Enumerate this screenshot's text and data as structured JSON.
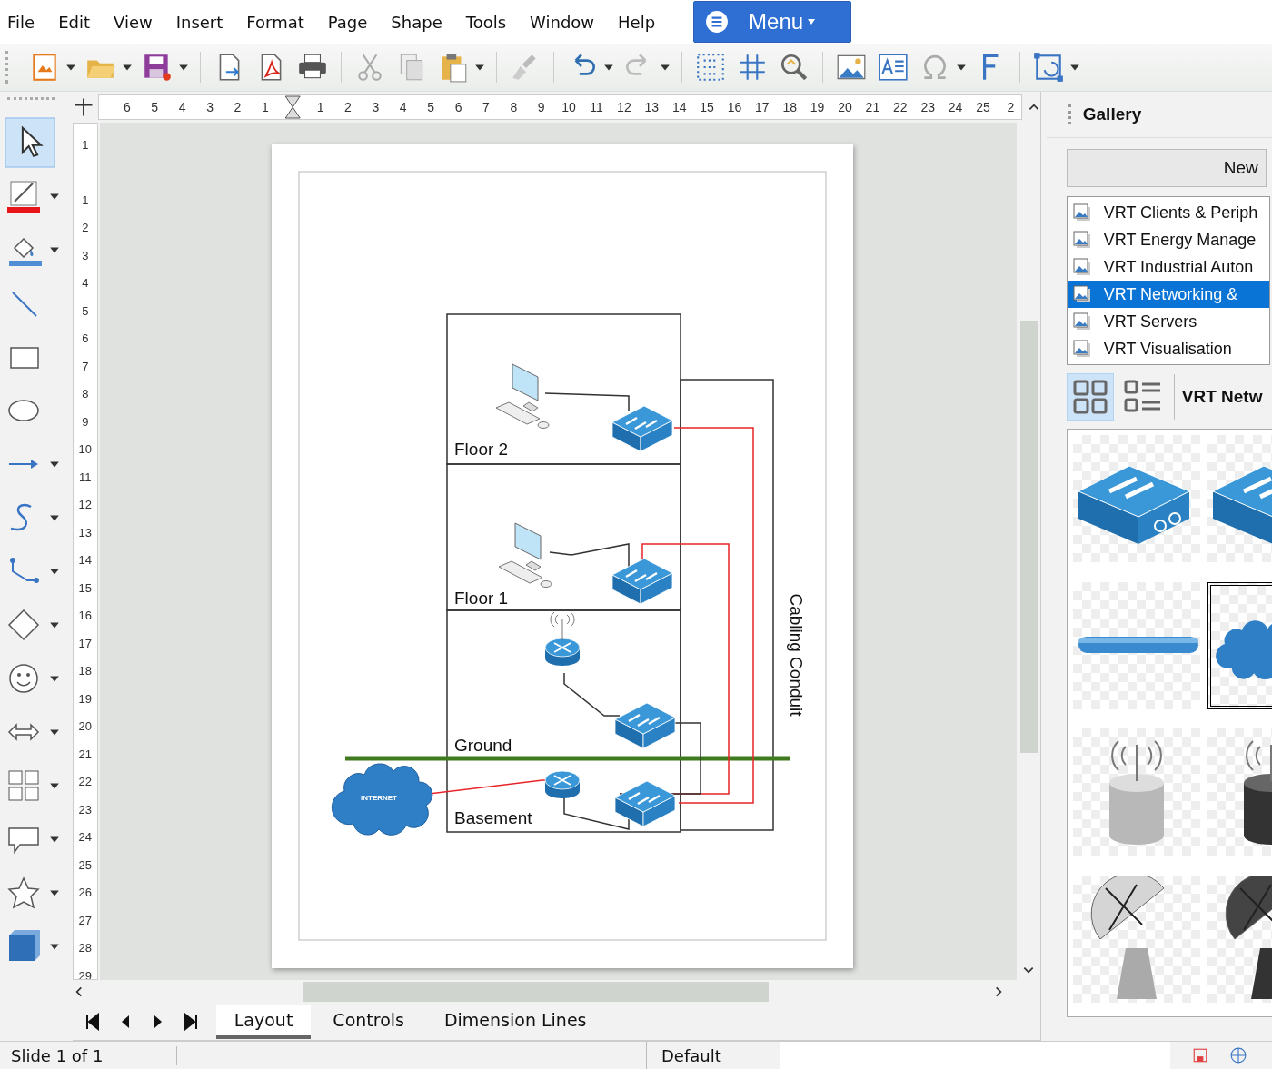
{
  "menu_bar": {
    "items": [
      "File",
      "Edit",
      "View",
      "Insert",
      "Format",
      "Page",
      "Shape",
      "Tools",
      "Window",
      "Help"
    ],
    "menu_button": "Menu"
  },
  "rulers": {
    "horizontal_before": [
      "6",
      "5",
      "4",
      "3",
      "2",
      "1"
    ],
    "horizontal_after": [
      "1",
      "2",
      "3",
      "4",
      "5",
      "6",
      "7",
      "8",
      "9",
      "10",
      "11",
      "12",
      "13",
      "14",
      "15",
      "16",
      "17",
      "18",
      "19",
      "20",
      "21",
      "22",
      "23",
      "24",
      "25",
      "2"
    ],
    "vertical_before": [
      "1"
    ],
    "vertical_after": [
      "1",
      "2",
      "3",
      "4",
      "5",
      "6",
      "7",
      "8",
      "9",
      "10",
      "11",
      "12",
      "13",
      "14",
      "15",
      "16",
      "17",
      "18",
      "19",
      "20",
      "21",
      "22",
      "23",
      "24",
      "25",
      "26",
      "27",
      "28",
      "29"
    ]
  },
  "diagram": {
    "floor_labels": [
      "Floor 2",
      "Floor 1",
      "Ground",
      "Basement"
    ],
    "conduit_label": "Cabling Conduit",
    "cloud_label": "INTERNET"
  },
  "page_tabs": [
    {
      "label": "Layout",
      "selected": true
    },
    {
      "label": "Controls",
      "selected": false
    },
    {
      "label": "Dimension Lines",
      "selected": false
    }
  ],
  "gallery": {
    "title": "Gallery",
    "new_theme_button": "New",
    "themes": [
      {
        "label": "VRT Clients & Periph",
        "selected": false
      },
      {
        "label": "VRT Energy Manage",
        "selected": false
      },
      {
        "label": "VRT Industrial Auton",
        "selected": false
      },
      {
        "label": "VRT Networking &",
        "selected": true
      },
      {
        "label": "VRT Servers",
        "selected": false
      },
      {
        "label": "VRT Visualisation",
        "selected": false
      }
    ],
    "view_modes": [
      {
        "kind": "icons",
        "selected": true
      },
      {
        "kind": "details",
        "selected": false
      }
    ],
    "theme_title": "VRT Netw"
  },
  "status_bar": {
    "slide": "Slide 1 of 1",
    "layout": "Default"
  }
}
